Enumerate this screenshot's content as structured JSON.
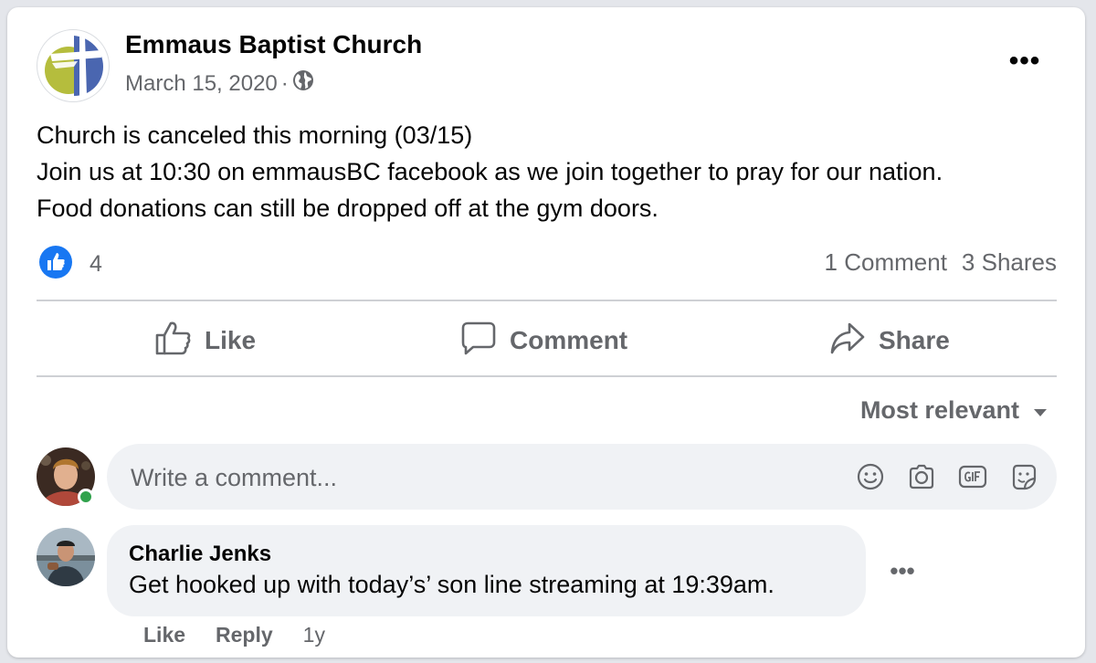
{
  "post": {
    "page_name": "Emmaus Baptist Church",
    "date": "March 15, 2020",
    "separator": "·",
    "more_label": "•••",
    "text_lines": [
      "Church is canceled this morning (03/15)",
      "Join us at 10:30 on emmausBC facebook as we join together to pray for our nation.",
      "Food donations can still be dropped off at the gym doors."
    ],
    "reaction_count": "4",
    "comments_count": "1 Comment",
    "shares_count": "3 Shares"
  },
  "actions": {
    "like": "Like",
    "comment": "Comment",
    "share": "Share"
  },
  "comments_section": {
    "sort_label": "Most relevant",
    "composer_placeholder": "Write a comment..."
  },
  "comment": {
    "author": "Charlie Jenks",
    "text": "Get hooked up with today’s’ son line streaming at 19:39am.",
    "like": "Like",
    "reply": "Reply",
    "time": "1y",
    "more_label": "•••"
  },
  "colors": {
    "facebook_blue": "#1877f2",
    "secondary_text": "#65676b",
    "online_green": "#31a24c",
    "logo_green": "#b5bd3d",
    "logo_blue": "#4a66b0"
  }
}
